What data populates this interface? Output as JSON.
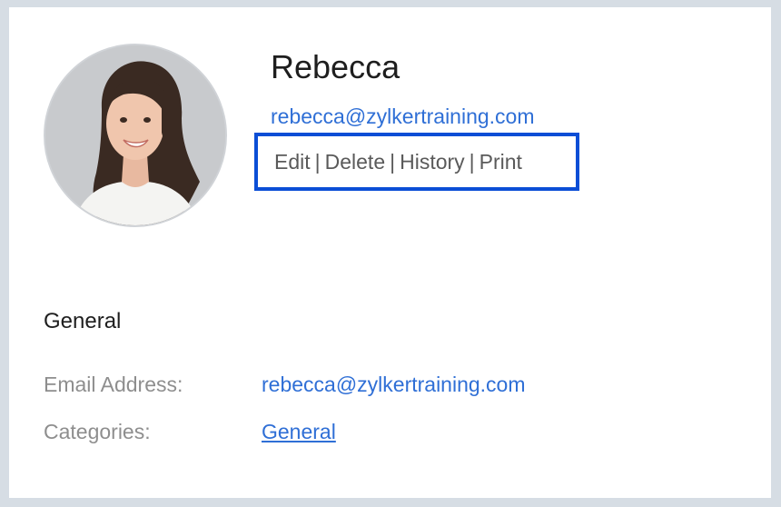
{
  "contact": {
    "name": "Rebecca",
    "email": "rebecca@zylkertraining.com"
  },
  "actions": {
    "edit": "Edit",
    "delete": "Delete",
    "history": "History",
    "print": "Print",
    "separator": "|"
  },
  "general": {
    "title": "General",
    "email_label": "Email Address:",
    "email_value": "rebecca@zylkertraining.com",
    "categories_label": "Categories:",
    "categories_value": "General"
  },
  "colors": {
    "link": "#2f6fd6",
    "highlight_border": "#0b4ed6",
    "label": "#8e8e8e",
    "page_bg": "#d6dde4"
  }
}
